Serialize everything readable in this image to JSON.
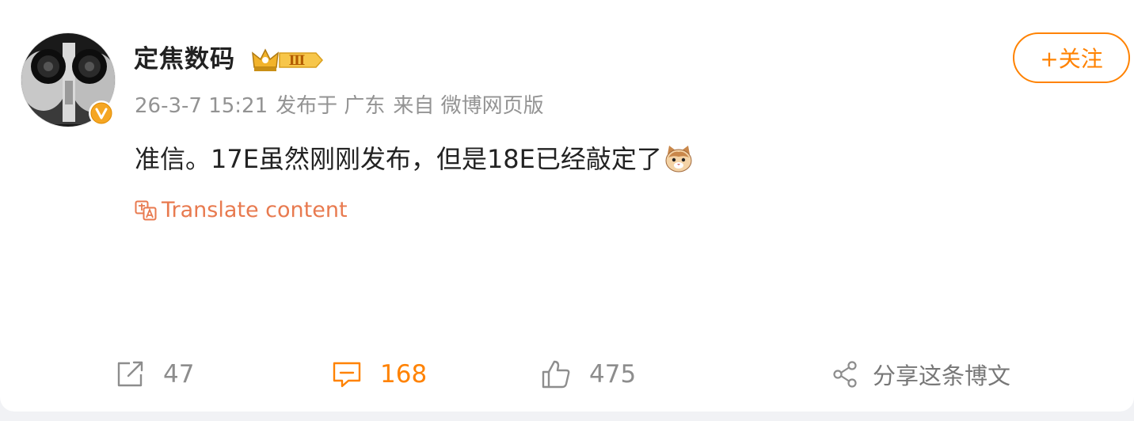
{
  "user": {
    "name": "定焦数码",
    "vip_level": "Ⅲ",
    "verified_mark": "V"
  },
  "meta": {
    "timestamp": "26-3-7 15:21",
    "location": "发布于 广东",
    "source": "来自 微博网页版"
  },
  "follow_label": "+关注",
  "post": {
    "text": "准信。17E虽然刚刚发布，但是18E已经敲定了"
  },
  "translate_label": "Translate content",
  "actions": {
    "repost_count": "47",
    "comment_count": "168",
    "like_count": "475",
    "share_label": "分享这条博文"
  },
  "colors": {
    "accent": "#ff8200",
    "translate": "#e87a4f",
    "muted": "#939393",
    "text": "#222222"
  },
  "icons": [
    "verified-icon",
    "vip-crown-icon",
    "cat-emoji-icon",
    "translate-icon",
    "repost-icon",
    "comment-icon",
    "like-icon",
    "share-icon"
  ]
}
